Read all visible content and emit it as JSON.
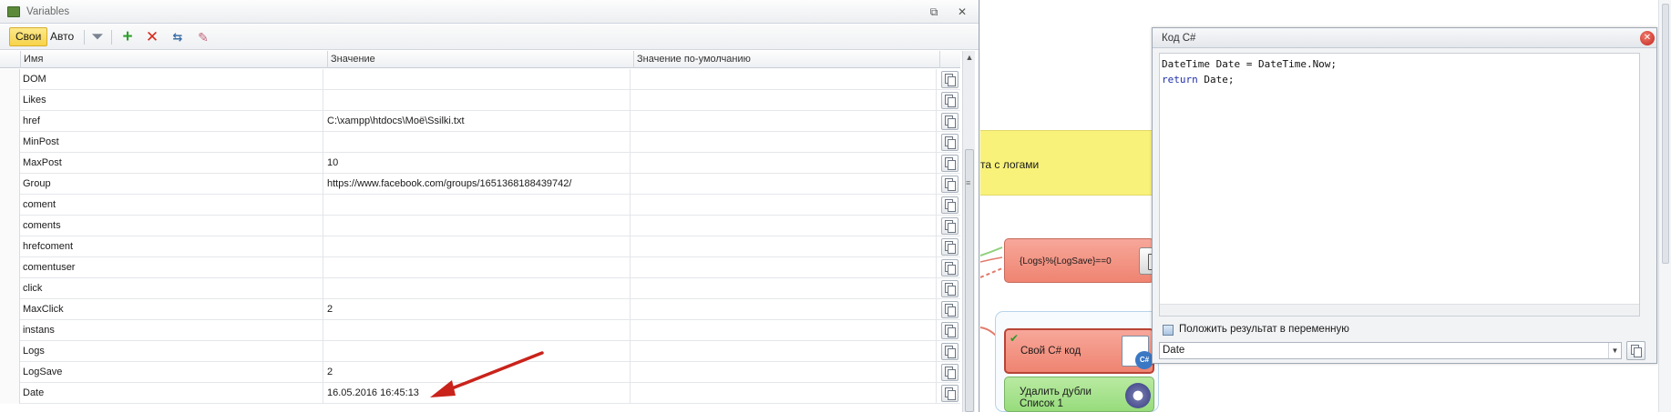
{
  "variables_panel": {
    "title": "Variables",
    "restore_glyph": "⧉",
    "close_glyph": "✕",
    "toolbar": {
      "own_label": "Свои",
      "auto_label": "Авто"
    },
    "columns": {
      "name": "Имя",
      "value": "Значение",
      "default": "Значение по-умолчанию"
    },
    "rows": [
      {
        "name": "DOM",
        "value": ""
      },
      {
        "name": "Likes",
        "value": ""
      },
      {
        "name": "href",
        "value": "C:\\xampp\\htdocs\\Моё\\Ssilki.txt"
      },
      {
        "name": "MinPost",
        "value": ""
      },
      {
        "name": "MaxPost",
        "value": "10"
      },
      {
        "name": "Group",
        "value": "https://www.facebook.com/groups/1651368188439742/"
      },
      {
        "name": "coment",
        "value": ""
      },
      {
        "name": "coments",
        "value": ""
      },
      {
        "name": "hrefcoment",
        "value": ""
      },
      {
        "name": "comentuser",
        "value": ""
      },
      {
        "name": "click",
        "value": ""
      },
      {
        "name": "MaxClick",
        "value": "2"
      },
      {
        "name": "instans",
        "value": ""
      },
      {
        "name": "Logs",
        "value": ""
      },
      {
        "name": "LogSave",
        "value": "2"
      },
      {
        "name": "Date",
        "value": "16.05.2016 16:45:13"
      }
    ]
  },
  "canvas": {
    "log_note_text": "та с логами",
    "node_logs_label": "{Logs}%{LogSave}==0",
    "node_csharp_label": "Свой C# код",
    "node_dedupe_line1": "Удалить дубли",
    "node_dedupe_line2": "Список 1"
  },
  "code_dialog": {
    "title": "Код C#",
    "close_glyph": "✕",
    "code_line1": "DateTime Date = DateTime.Now;",
    "code_line2_kw": "return",
    "code_line2_rest": " Date;",
    "result_checkbox_label": "Положить результат в переменную",
    "result_variable": "Date",
    "dropdown_glyph": "▼"
  },
  "colors": {
    "accent_active_toggle": "#f7d34a",
    "note_yellow": "#f8f27a",
    "node_red": "#ef8471",
    "node_green": "#97dc7c",
    "arrow_red": "#c9231b"
  }
}
